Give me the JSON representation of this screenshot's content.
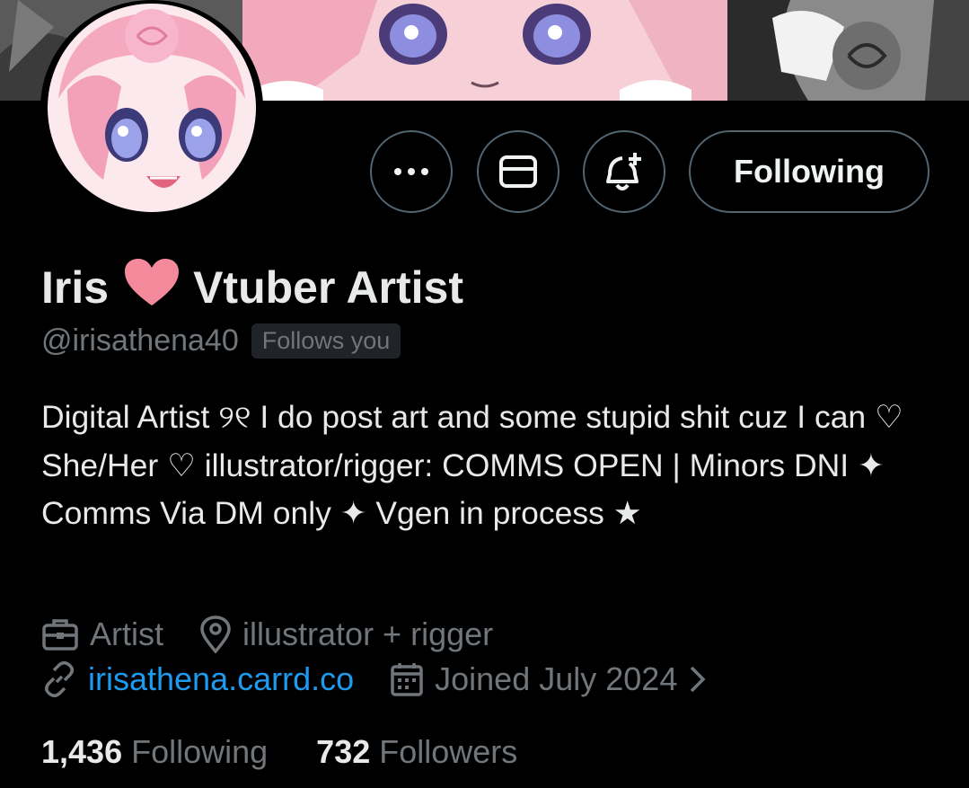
{
  "profile": {
    "display_name_part1": "Iris",
    "display_name_part2": "Vtuber Artist",
    "heart_icon": "pink-heart-emoji",
    "handle": "@irisathena40",
    "follows_you": "Follows you",
    "bio": "Digital Artist ୨୧ I do post art and some stupid shit cuz I can ♡ She/Her ♡ illustrator/rigger: COMMS OPEN | Minors DNI ✦ Comms Via DM only ✦ Vgen in process ★"
  },
  "actions": {
    "more_icon": "more-dots-icon",
    "mail_icon": "envelope-icon",
    "notify_icon": "bell-plus-icon",
    "following_label": "Following"
  },
  "meta": {
    "category": "Artist",
    "location": "illustrator + rigger",
    "website": "irisathena.carrd.co",
    "joined": "Joined July 2024"
  },
  "stats": {
    "following_count": "1,436",
    "following_label": "Following",
    "followers_count": "732",
    "followers_label": "Followers"
  },
  "colors": {
    "background": "#000000",
    "text_primary": "#e7e9ea",
    "text_secondary": "#71767b",
    "link": "#1d9bf0",
    "border": "#536471",
    "heart": "#f4899b"
  }
}
